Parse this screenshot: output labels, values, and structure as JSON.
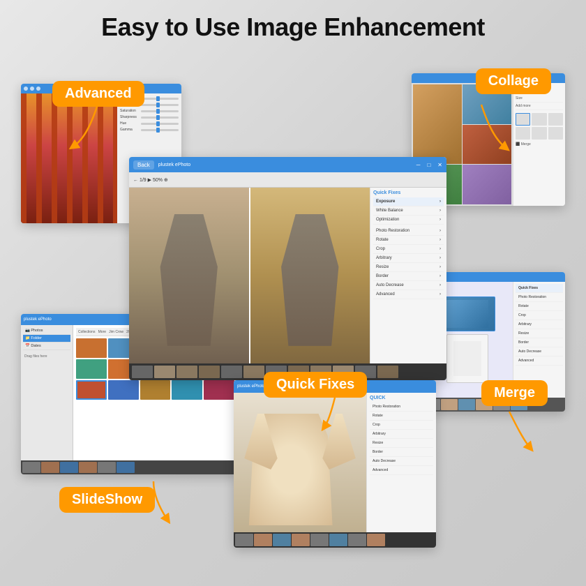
{
  "page": {
    "title": "Easy to Use Image Enhancement",
    "bg_color": "#d8d8d8"
  },
  "labels": {
    "advanced": "Advanced",
    "collage": "Collage",
    "quick_fixes": "Quick Fixes",
    "slideshow": "SlideShow",
    "merge": "Merge"
  },
  "cards": {
    "main": {
      "back_btn": "Back",
      "panel_items": [
        {
          "name": "Quick Fixes",
          "highlight": true
        },
        {
          "name": "Exposure"
        },
        {
          "name": "White Balance"
        },
        {
          "name": "Optimization"
        },
        {
          "name": "Photo Restoration"
        },
        {
          "name": "Rotate"
        },
        {
          "name": "Crop"
        },
        {
          "name": "Arbitrary"
        },
        {
          "name": "Resize"
        },
        {
          "name": "Border"
        },
        {
          "name": "Auto Decrease"
        },
        {
          "name": "Advanced"
        }
      ]
    },
    "quickfix": {
      "panel_items": [
        {
          "name": "Quick Fixes",
          "highlight": true
        },
        {
          "name": "Photo Restoration"
        },
        {
          "name": "Rotate"
        },
        {
          "name": "Crop"
        },
        {
          "name": "Arbitrary"
        },
        {
          "name": "Resize"
        },
        {
          "name": "Border"
        },
        {
          "name": "Auto Decrease"
        },
        {
          "name": "Advanced"
        }
      ]
    }
  },
  "icons": {
    "chevron": "›",
    "close": "✕",
    "minimize": "─",
    "maximize": "□"
  }
}
